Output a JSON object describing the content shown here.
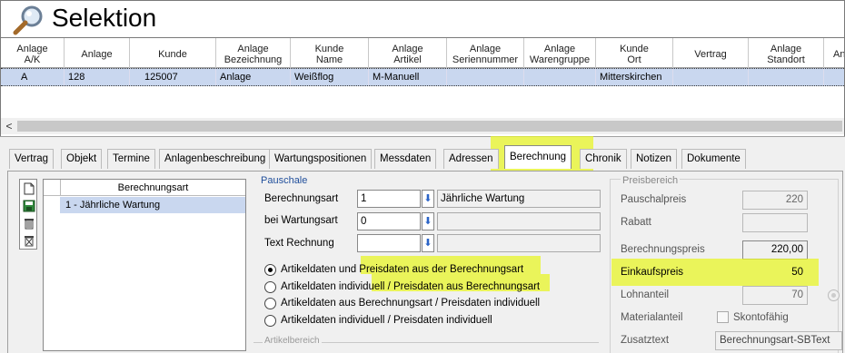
{
  "window": {
    "title": "Selektion"
  },
  "grid": {
    "columns": [
      "Anlage\nA/K",
      "Anlage",
      "Kunde",
      "Anlage\nBezeichnung",
      "Kunde\nName",
      "Anlage\nArtikel",
      "Anlage\nSeriennummer",
      "Anlage\nWarengruppe",
      "Kunde\nOrt",
      "Vertrag",
      "Anlage\nStandort",
      "An"
    ],
    "rows": [
      [
        "A",
        "128",
        "125007",
        "Anlage",
        "Weißflog",
        "M-Manuell",
        "",
        "",
        "Mitterskirchen",
        "",
        "",
        ""
      ]
    ]
  },
  "tabs": [
    {
      "label": "Vertrag"
    },
    {
      "label": "Objekt"
    },
    {
      "label": "Termine"
    },
    {
      "label": "Anlagenbeschreibung"
    },
    {
      "label": "Wartungspositionen"
    },
    {
      "label": "Messdaten"
    },
    {
      "label": "Adressen"
    },
    {
      "label": "Berechnung"
    },
    {
      "label": "Chronik"
    },
    {
      "label": "Notizen"
    },
    {
      "label": "Dokumente"
    }
  ],
  "berechnungsart_list": {
    "header": "Berechnungsart",
    "items": [
      "1 - Jährliche Wartung"
    ]
  },
  "pauschale": {
    "legend": "Pauschale",
    "berechnungsart_label": "Berechnungsart",
    "berechnungsart_value": "1",
    "berechnungsart_desc": "Jährliche Wartung",
    "bei_wartungsart_label": "bei Wartungsart",
    "bei_wartungsart_value": "0",
    "text_rechnung_label": "Text Rechnung",
    "text_rechnung_value": "",
    "radios": [
      {
        "label": "Artikeldaten und Preisdaten aus der Berechnungsart",
        "checked": true
      },
      {
        "label": "Artikeldaten individuell / Preisdaten aus Berechnungsart",
        "checked": false
      },
      {
        "label": "Artikeldaten aus Berechnungsart / Preisdaten individuell",
        "checked": false
      },
      {
        "label": "Artikeldaten individuell / Preisdaten individuell",
        "checked": false
      }
    ],
    "artikelbereich_legend": "Artikelbereich"
  },
  "preisbereich": {
    "legend": "Preisbereich",
    "pauschalpreis_label": "Pauschalpreis",
    "pauschalpreis_value": "220",
    "rabatt_label": "Rabatt",
    "rabatt_value": "",
    "berechnungspreis_label": "Berechnungspreis",
    "berechnungspreis_value": "220,00",
    "einkaufspreis_label": "Einkaufspreis",
    "einkaufspreis_value": "50",
    "lohnanteil_label": "Lohnanteil",
    "lohnanteil_value": "70",
    "materialanteil_label": "Materialanteil",
    "skonto_label": "Skontofähig",
    "zusatztext_label": "Zusatztext",
    "zusatztext_value": "Berechnungsart-SBText"
  },
  "colors": {
    "highlight": "#e8f528",
    "selected_row": "#c9d7ef",
    "legend_blue": "#1f4e9b"
  },
  "icons": [
    "search-icon",
    "new-document-icon",
    "save-icon",
    "delete-icon",
    "delete-all-icon",
    "lookup-arrow-icon"
  ]
}
